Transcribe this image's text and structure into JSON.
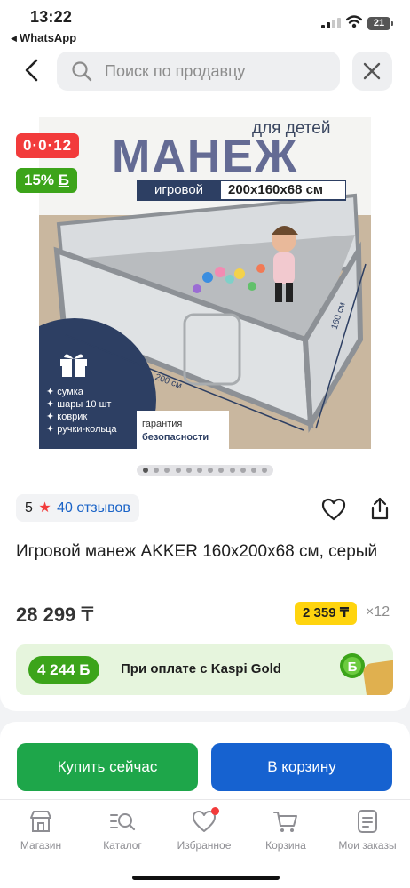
{
  "status_bar": {
    "time": "13:22",
    "back_app": "WhatsApp",
    "battery": "21"
  },
  "search": {
    "placeholder": "Поиск по продавцу"
  },
  "product_image": {
    "for_kids": "для детей",
    "headline": "МАНЕЖ",
    "type_label": "игровой",
    "size_label": "200x160x68 см",
    "bundle_items": [
      "сумка",
      "шары 10 шт",
      "коврик",
      "ручки-кольца"
    ],
    "dim_width": "200 см",
    "dim_depth": "160 см",
    "guarantee_line1": "гарантия",
    "guarantee_line2": "безопасности",
    "page_count": 12,
    "current_page": 1
  },
  "badges": {
    "timer": "0·0·12",
    "discount": "15%",
    "discount_currency": "Б"
  },
  "rating": {
    "score": "5",
    "reviews": "40 отзывов"
  },
  "product": {
    "title": "Игровой манеж AKKER 160x200x68 см, серый",
    "price": "28 299",
    "currency": "₸",
    "installment_price": "2 359 ₸",
    "installment_months": "×12"
  },
  "kaspi_gold": {
    "bonus": "4 244",
    "bonus_currency": "Б",
    "text": "При оплате с Kaspi Gold"
  },
  "actions": {
    "buy_now": "Купить сейчас",
    "to_cart": "В корзину"
  },
  "tabbar": {
    "items": [
      {
        "label": "Магазин",
        "icon": "store-icon"
      },
      {
        "label": "Каталог",
        "icon": "catalog-search-icon"
      },
      {
        "label": "Избранное",
        "icon": "heart-icon"
      },
      {
        "label": "Корзина",
        "icon": "cart-icon"
      },
      {
        "label": "Мои заказы",
        "icon": "orders-icon"
      }
    ]
  },
  "colors": {
    "accent_red": "#f23b3b",
    "green": "#3ca41a",
    "blue": "#1662d0",
    "yellow": "#ffd40e"
  }
}
